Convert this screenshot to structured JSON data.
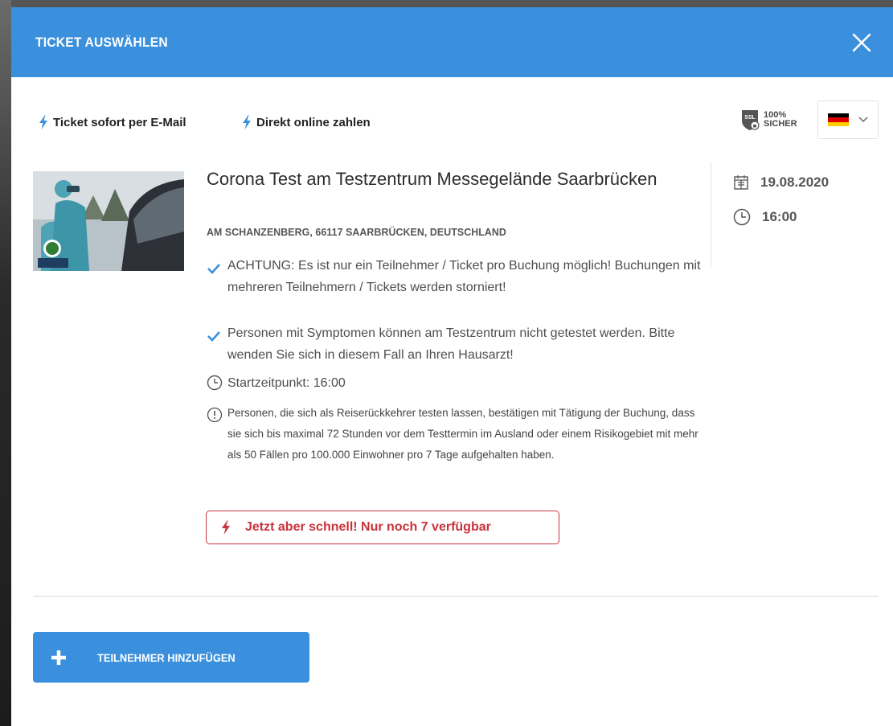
{
  "header": {
    "title": "TICKET AUSWÄHLEN"
  },
  "features": [
    {
      "label": "Ticket sofort per E-Mail",
      "icon": "lightning-icon"
    },
    {
      "label": "Direkt online zahlen",
      "icon": "lightning-icon"
    }
  ],
  "badge": {
    "ssl": "SSL",
    "percent": "100%",
    "word": "SICHER"
  },
  "language": {
    "selected": "de",
    "icon": "chevron-down-icon"
  },
  "event": {
    "title": "Corona Test am Testzentrum Messegelände Saarbrücken",
    "address": "AM SCHANZENBERG, 66117 SAARBRÜCKEN, DEUTSCHLAND",
    "notes": [
      "ACHTUNG: Es ist nur ein Teilnehmer / Ticket pro Buchung möglich! Buchungen mit mehreren Teilnehmern / Tickets werden storniert!",
      "Personen mit Symptomen können am Testzentrum nicht getestet werden. Bitte wenden Sie sich in diesem Fall an Ihren Hausarzt!"
    ],
    "start": "Startzeitpunkt: 16:00",
    "disclaimer": "Personen, die sich als Reiserückkehrer testen lassen, bestätigen mit Tätigung der Buchung, dass sie sich bis maximal 72 Stunden vor dem Testtermin im Ausland oder einem Risikogebiet mit mehr als 50 Fällen pro 100.000 Einwohner pro 7 Tage aufgehalten haben.",
    "urgency": "Jetzt aber schnell! Nur noch 7 verfügbar",
    "date": "19.08.2020",
    "time": "16:00"
  },
  "actions": {
    "add_participant": "TEILNEHMER HINZUFÜGEN"
  },
  "colors": {
    "primary": "#3a90dc",
    "danger": "#c9323b",
    "check": "#3a90dc"
  }
}
